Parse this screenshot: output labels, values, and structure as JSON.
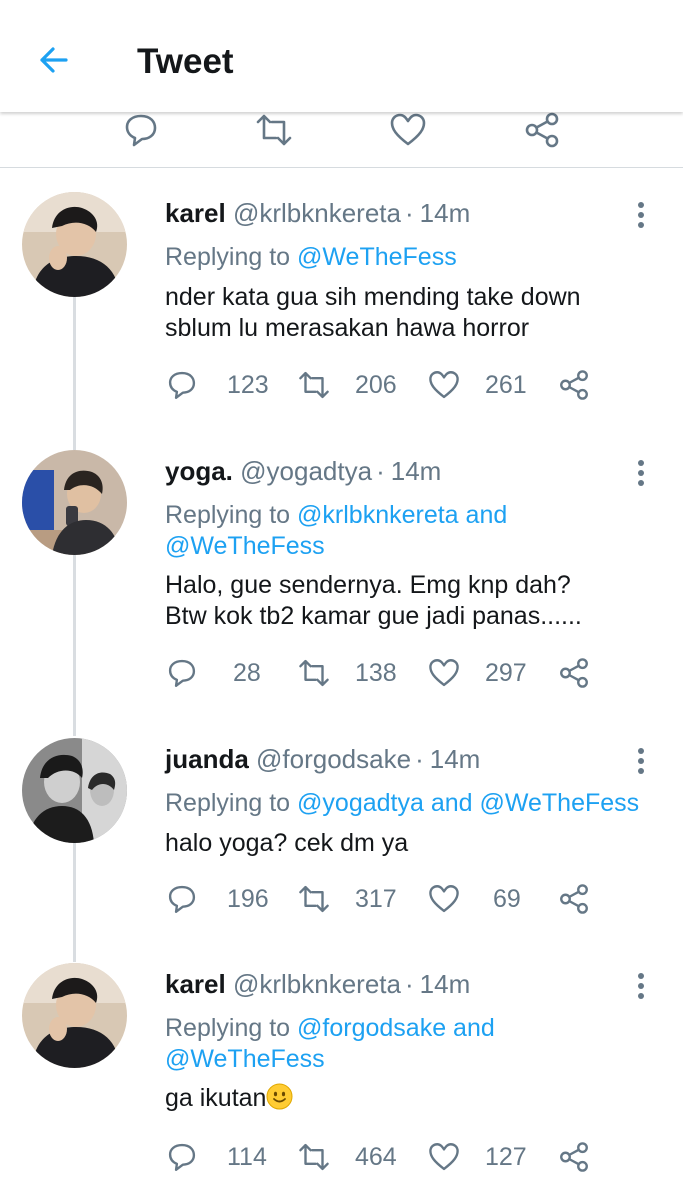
{
  "header": {
    "title": "Tweet"
  },
  "replies": [
    {
      "name": "karel",
      "handle": "@krlbknkereta",
      "time": "14m",
      "replying_prefix": "Replying to ",
      "mention1": "@WeTheFess",
      "conj": "",
      "mention2": "",
      "text_lines": [
        "nder kata gua sih mending take down",
        "sblum lu merasakan hawa horror"
      ],
      "counts": {
        "replies": "123",
        "retweets": "206",
        "likes": "261"
      }
    },
    {
      "name": "yoga.",
      "handle": "@yogadtya",
      "time": "14m",
      "replying_prefix": "Replying to ",
      "mention1": "@krlbknkereta",
      "conj": " and",
      "mention2": "@WeTheFess",
      "text_lines": [
        "Halo, gue sendernya. Emg knp dah?",
        "Btw kok tb2 kamar gue jadi panas......"
      ],
      "counts": {
        "replies": "28",
        "retweets": "138",
        "likes": "297"
      }
    },
    {
      "name": "juanda",
      "handle": "@forgodsake",
      "time": "14m",
      "replying_prefix": "Replying to ",
      "mention1": "@yogadtya",
      "conj": " and ",
      "mention2": "@WeTheFess",
      "text_lines": [
        "halo yoga? cek dm ya",
        ""
      ],
      "counts": {
        "replies": "196",
        "retweets": "317",
        "likes": "69"
      }
    },
    {
      "name": "karel",
      "handle": "@krlbknkereta",
      "time": "14m",
      "replying_prefix": "Replying to ",
      "mention1": "@forgodsake",
      "conj": " and",
      "mention2": "@WeTheFess",
      "text_lines": [
        "ga ikutan",
        ""
      ],
      "counts": {
        "replies": "114",
        "retweets": "464",
        "likes": "127"
      }
    }
  ],
  "colors": {
    "accent": "#1da1f2",
    "secondary_text": "#657786",
    "primary_text": "#14171a"
  }
}
